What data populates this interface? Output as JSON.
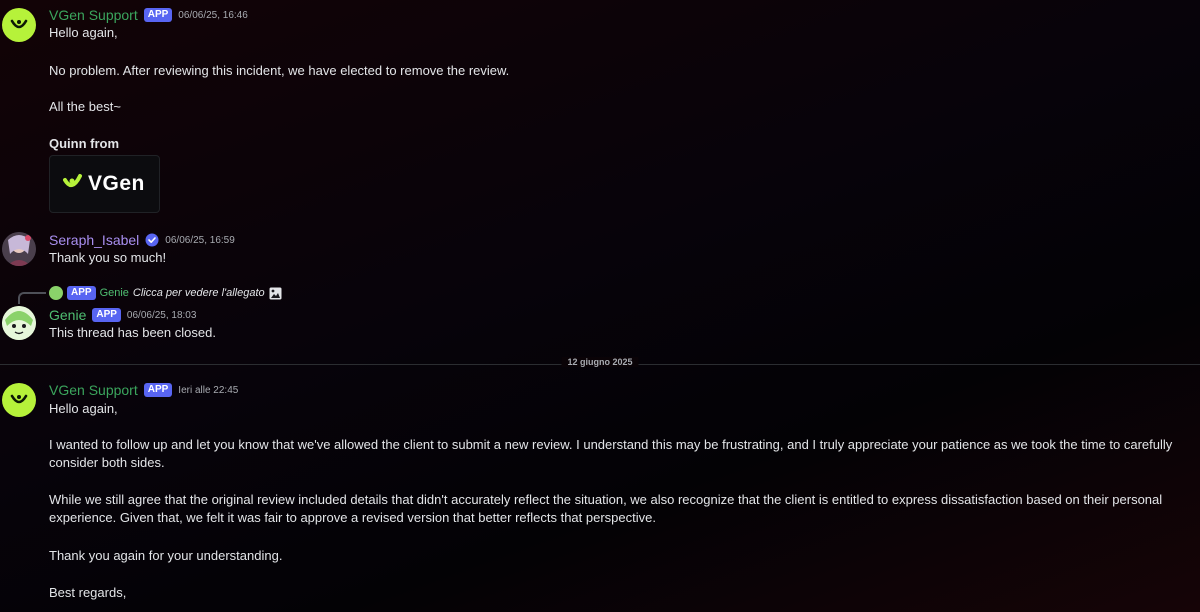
{
  "messages": [
    {
      "author": "VGen Support",
      "badge": "APP",
      "time": "06/06/25, 16:46",
      "lines": [
        "Hello again,",
        "No problem. After reviewing this incident, we have elected to remove the review.",
        "All the best~",
        "Quinn from"
      ],
      "embed_logo_text": "VGen"
    },
    {
      "author": "Seraph_Isabel",
      "time": "06/06/25, 16:59",
      "lines": [
        "Thank you so much!"
      ]
    },
    {
      "reply": {
        "badge": "APP",
        "name": "Genie",
        "text": "Clicca per vedere l'allegato"
      },
      "author": "Genie",
      "badge": "APP",
      "time": "06/06/25, 18:03",
      "lines": [
        "This thread has been closed."
      ]
    },
    {
      "author": "VGen Support",
      "badge": "APP",
      "time": "Ieri alle 22:45",
      "lines": [
        "Hello again,",
        "I wanted to follow up and let you know that we've allowed the client to submit a new review. I understand this may be frustrating, and I truly appreciate your patience as we took the time to carefully consider both sides.",
        "While we still agree that the original review included details that didn't accurately reflect the situation, we also recognize that the client is entitled to express dissatisfaction based on their personal experience. Given that, we felt it was fair to approve a revised version that better reflects that perspective.",
        "Thank you again for your understanding.",
        "Best regards,"
      ]
    }
  ],
  "date_divider": "12 giugno 2025",
  "colors": {
    "vgen_green": "#b6f23a",
    "app_badge": "#5865f2",
    "name_green": "#3ba55d",
    "name_purple": "#a98ff0"
  }
}
